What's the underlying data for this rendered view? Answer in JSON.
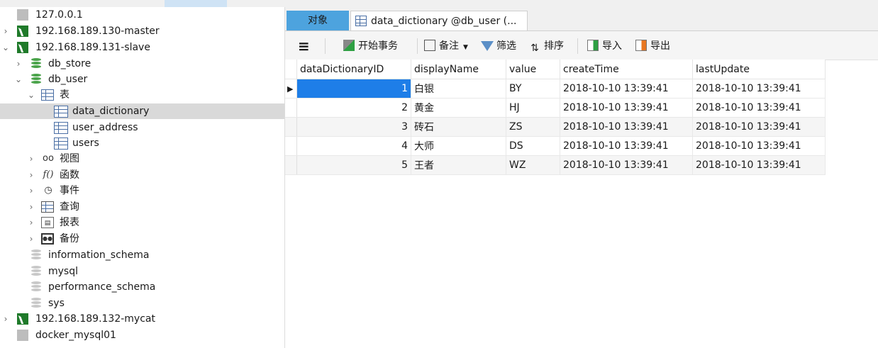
{
  "sidebar": {
    "items": [
      {
        "label": "127.0.0.1",
        "kind": "conn-off"
      },
      {
        "label": "192.168.189.130-master",
        "kind": "conn-on"
      },
      {
        "label": "192.168.189.131-slave",
        "kind": "conn-on"
      },
      {
        "label": "db_store",
        "kind": "db-green"
      },
      {
        "label": "db_user",
        "kind": "db-green"
      },
      {
        "label": "表",
        "kind": "table-folder"
      },
      {
        "label": "data_dictionary",
        "kind": "table"
      },
      {
        "label": "user_address",
        "kind": "table"
      },
      {
        "label": "users",
        "kind": "table"
      },
      {
        "label": "视图",
        "kind": "view"
      },
      {
        "label": "函数",
        "kind": "function"
      },
      {
        "label": "事件",
        "kind": "event"
      },
      {
        "label": "查询",
        "kind": "query"
      },
      {
        "label": "报表",
        "kind": "report"
      },
      {
        "label": "备份",
        "kind": "backup"
      },
      {
        "label": "information_schema",
        "kind": "db-gray"
      },
      {
        "label": "mysql",
        "kind": "db-gray"
      },
      {
        "label": "performance_schema",
        "kind": "db-gray"
      },
      {
        "label": "sys",
        "kind": "db-gray"
      },
      {
        "label": "192.168.189.132-mycat",
        "kind": "conn-on"
      },
      {
        "label": "docker_mysql01",
        "kind": "conn-off"
      }
    ]
  },
  "tabs": {
    "objects": "对象",
    "active": "data_dictionary @db_user (..."
  },
  "toolbar": {
    "menu_icon": "≡",
    "begin_transaction": "开始事务",
    "memo": "备注",
    "filter": "筛选",
    "sort": "排序",
    "import": "导入",
    "export": "导出"
  },
  "grid": {
    "columns": [
      "dataDictionaryID",
      "displayName",
      "value",
      "createTime",
      "lastUpdate"
    ],
    "rows": [
      [
        "1",
        "白银",
        "BY",
        "2018-10-10 13:39:41",
        "2018-10-10 13:39:41"
      ],
      [
        "2",
        "黄金",
        "HJ",
        "2018-10-10 13:39:41",
        "2018-10-10 13:39:41"
      ],
      [
        "3",
        "砖石",
        "ZS",
        "2018-10-10 13:39:41",
        "2018-10-10 13:39:41"
      ],
      [
        "4",
        "大师",
        "DS",
        "2018-10-10 13:39:41",
        "2018-10-10 13:39:41"
      ],
      [
        "5",
        "王者",
        "WZ",
        "2018-10-10 13:39:41",
        "2018-10-10 13:39:41"
      ]
    ],
    "current_row_marker": "▶"
  },
  "colors": {
    "selection": "#1e7ee8",
    "active_tab": "#4da3de",
    "connection": "#1f7a2a"
  }
}
